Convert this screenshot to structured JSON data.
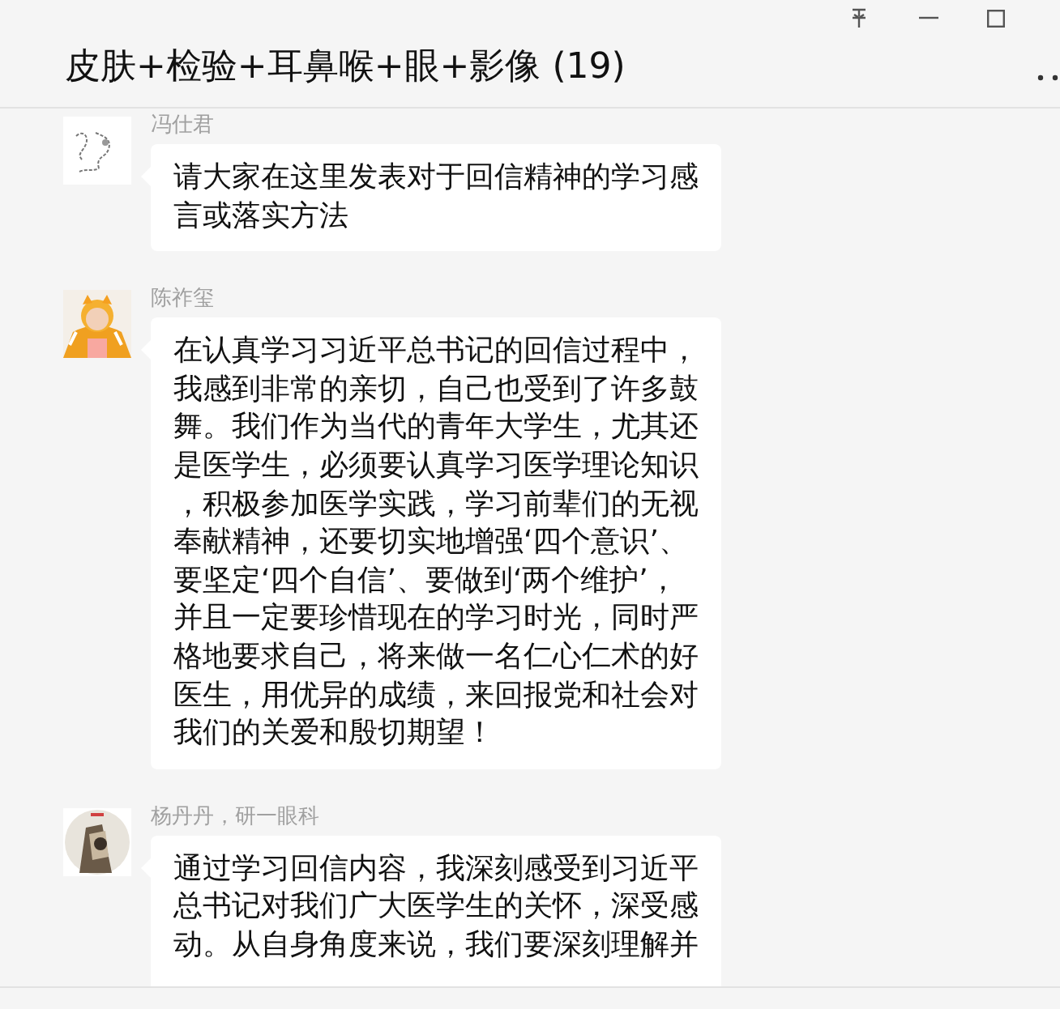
{
  "window": {
    "title": "皮肤+检验+耳鼻喉+眼+影像 (19)"
  },
  "messages": [
    {
      "sender": "冯仕君",
      "text": "请大家在这里发表对于回信精神的学习感言或落实方法"
    },
    {
      "sender": "陈祚玺",
      "text": "在认真学习习近平总书记的回信过程中，我感到非常的亲切，自己也受到了许多鼓舞。我们作为当代的青年大学生，尤其还是医学生，必须要认真学习医学理论知识，积极参加医学实践，学习前辈们的无视奉献精神，还要切实地增强‘四个意识’、要坚定‘四个自信’、要做到‘两个维护’，并且一定要珍惜现在的学习时光，同时严格地要求自己，将来做一名仁心仁术的好医生，用优异的成绩，来回报党和社会对我们的关爱和殷切期望！"
    },
    {
      "sender": "杨丹丹，研一眼科",
      "text": "通过学习回信内容，我深刻感受到习近平总书记对我们广大医学生的关怀，深受感动。从自身角度来说，我们要深刻理解并"
    }
  ]
}
